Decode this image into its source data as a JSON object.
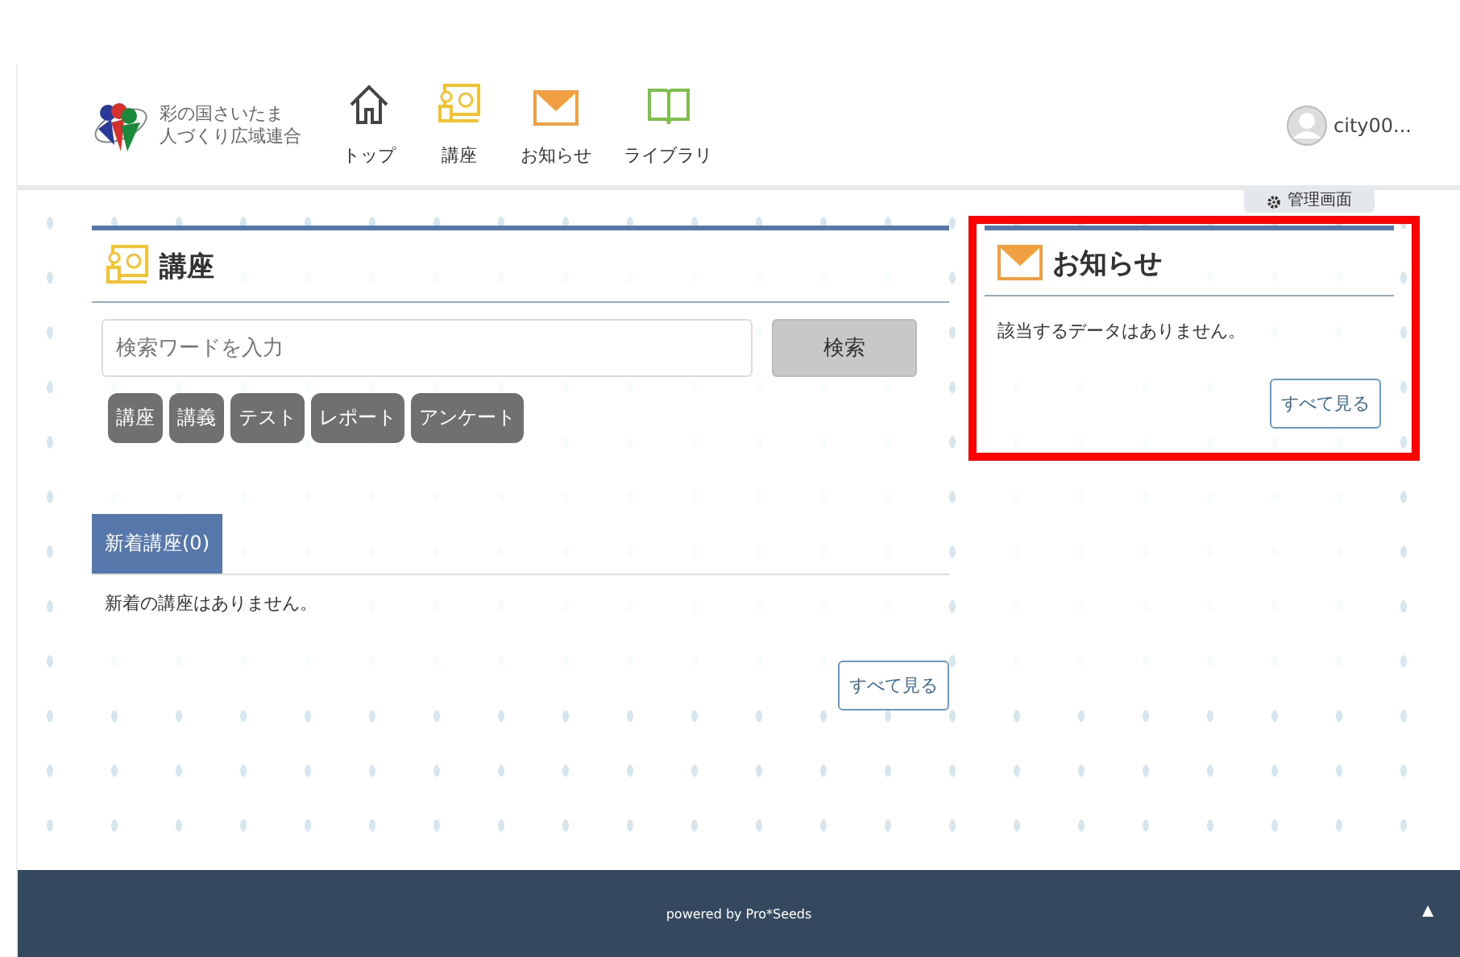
{
  "header": {
    "logo_text": [
      "彩の国さいたま",
      "人づくり広域連合"
    ],
    "nav": [
      {
        "kind": "home",
        "label": "トップ"
      },
      {
        "kind": "course",
        "label": "講座"
      },
      {
        "kind": "notice",
        "label": "お知らせ"
      },
      {
        "kind": "library",
        "label": "ライブラリ"
      }
    ],
    "user": "city00..."
  },
  "admin_tab": "管理画面",
  "course_panel": {
    "title": "講座",
    "search": {
      "placeholder": "検索ワードを入力"
    },
    "search_button": "検索",
    "filters": [
      "講座",
      "講義",
      "テスト",
      "レポート",
      "アンケート"
    ],
    "tab": "新着講座(0)",
    "empty_text": "新着の講座はありません。",
    "more_button": "すべて見る"
  },
  "notice_panel": {
    "title": "お知らせ",
    "empty_text": "該当するデータはありません。",
    "more_button": "すべて見る",
    "highlighted": true
  },
  "footer": {
    "text": "powered by Pro*Seeds",
    "top_button": "▲"
  }
}
